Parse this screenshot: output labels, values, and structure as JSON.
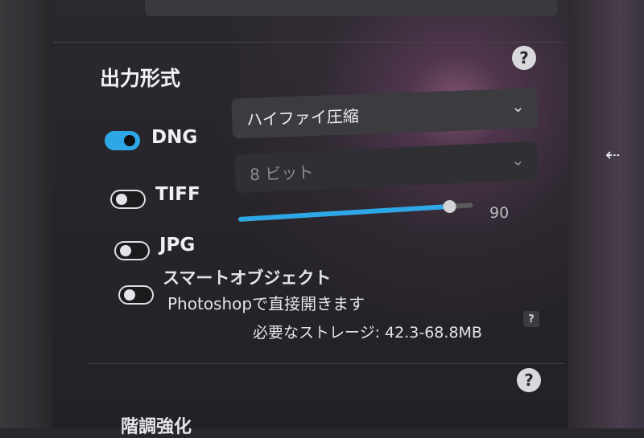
{
  "output_format": {
    "title": "出力形式",
    "help_icon": "question-mark-icon",
    "formats": [
      {
        "label": "DNG",
        "enabled": true,
        "option": "ハイファイ圧縮"
      },
      {
        "label": "TIFF",
        "enabled": false,
        "option": "8 ビット"
      },
      {
        "label": "JPG",
        "enabled": false,
        "quality": 90,
        "quality_label": "90"
      }
    ],
    "smart_object": {
      "label": "スマートオブジェクト",
      "subtitle": "Photoshopで直接開きます",
      "enabled": false
    },
    "storage_text": "必要なストレージ: 42.3-68.8MB",
    "storage_help": "?"
  },
  "next_section": {
    "title": "階調強化"
  },
  "help_symbol": "?",
  "colors": {
    "accent": "#2ea7e6",
    "panel_bg": "#262428"
  },
  "side_icon": "collapse-arrow-icon"
}
